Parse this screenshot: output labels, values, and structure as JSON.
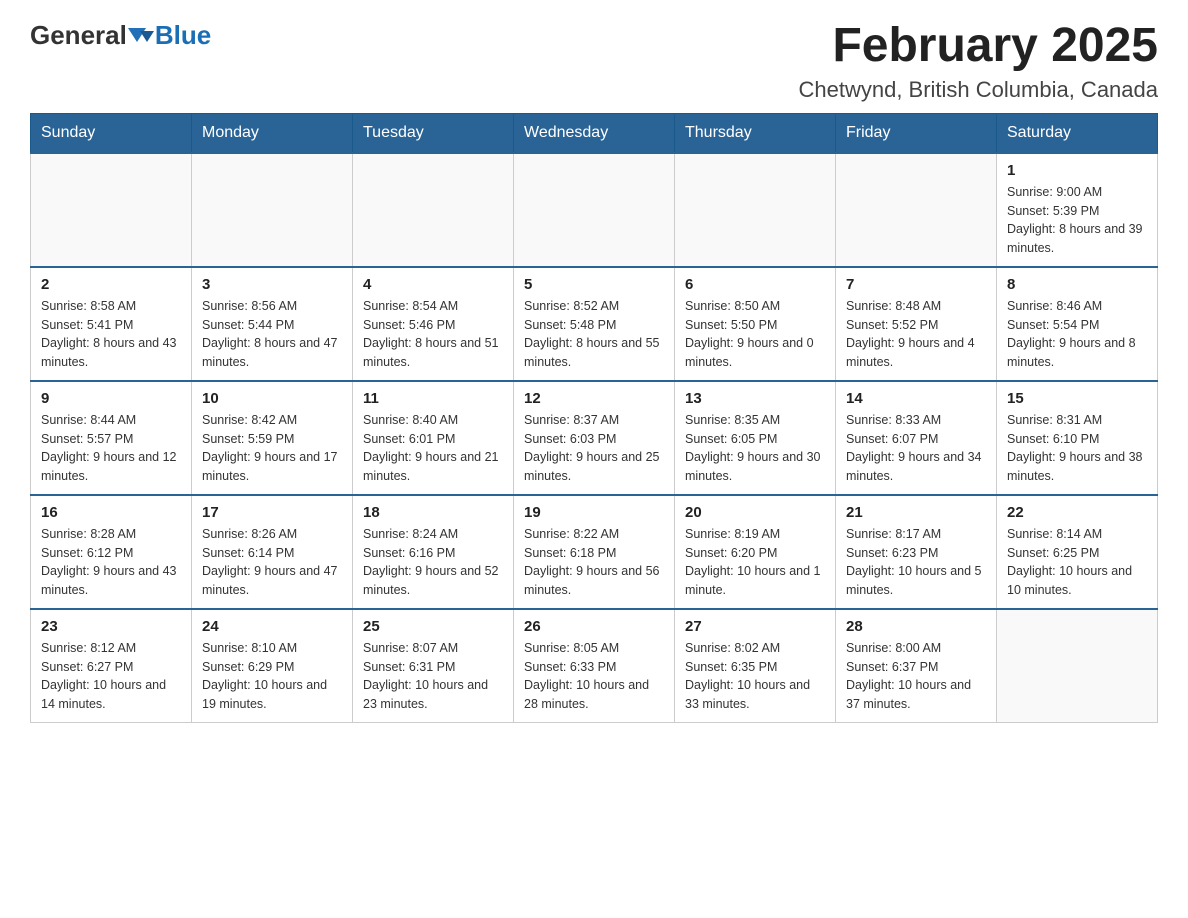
{
  "header": {
    "logo_general": "General",
    "logo_blue": "Blue",
    "title": "February 2025",
    "subtitle": "Chetwynd, British Columbia, Canada"
  },
  "days_of_week": [
    "Sunday",
    "Monday",
    "Tuesday",
    "Wednesday",
    "Thursday",
    "Friday",
    "Saturday"
  ],
  "weeks": [
    [
      {
        "day": "",
        "info": ""
      },
      {
        "day": "",
        "info": ""
      },
      {
        "day": "",
        "info": ""
      },
      {
        "day": "",
        "info": ""
      },
      {
        "day": "",
        "info": ""
      },
      {
        "day": "",
        "info": ""
      },
      {
        "day": "1",
        "info": "Sunrise: 9:00 AM\nSunset: 5:39 PM\nDaylight: 8 hours and 39 minutes."
      }
    ],
    [
      {
        "day": "2",
        "info": "Sunrise: 8:58 AM\nSunset: 5:41 PM\nDaylight: 8 hours and 43 minutes."
      },
      {
        "day": "3",
        "info": "Sunrise: 8:56 AM\nSunset: 5:44 PM\nDaylight: 8 hours and 47 minutes."
      },
      {
        "day": "4",
        "info": "Sunrise: 8:54 AM\nSunset: 5:46 PM\nDaylight: 8 hours and 51 minutes."
      },
      {
        "day": "5",
        "info": "Sunrise: 8:52 AM\nSunset: 5:48 PM\nDaylight: 8 hours and 55 minutes."
      },
      {
        "day": "6",
        "info": "Sunrise: 8:50 AM\nSunset: 5:50 PM\nDaylight: 9 hours and 0 minutes."
      },
      {
        "day": "7",
        "info": "Sunrise: 8:48 AM\nSunset: 5:52 PM\nDaylight: 9 hours and 4 minutes."
      },
      {
        "day": "8",
        "info": "Sunrise: 8:46 AM\nSunset: 5:54 PM\nDaylight: 9 hours and 8 minutes."
      }
    ],
    [
      {
        "day": "9",
        "info": "Sunrise: 8:44 AM\nSunset: 5:57 PM\nDaylight: 9 hours and 12 minutes."
      },
      {
        "day": "10",
        "info": "Sunrise: 8:42 AM\nSunset: 5:59 PM\nDaylight: 9 hours and 17 minutes."
      },
      {
        "day": "11",
        "info": "Sunrise: 8:40 AM\nSunset: 6:01 PM\nDaylight: 9 hours and 21 minutes."
      },
      {
        "day": "12",
        "info": "Sunrise: 8:37 AM\nSunset: 6:03 PM\nDaylight: 9 hours and 25 minutes."
      },
      {
        "day": "13",
        "info": "Sunrise: 8:35 AM\nSunset: 6:05 PM\nDaylight: 9 hours and 30 minutes."
      },
      {
        "day": "14",
        "info": "Sunrise: 8:33 AM\nSunset: 6:07 PM\nDaylight: 9 hours and 34 minutes."
      },
      {
        "day": "15",
        "info": "Sunrise: 8:31 AM\nSunset: 6:10 PM\nDaylight: 9 hours and 38 minutes."
      }
    ],
    [
      {
        "day": "16",
        "info": "Sunrise: 8:28 AM\nSunset: 6:12 PM\nDaylight: 9 hours and 43 minutes."
      },
      {
        "day": "17",
        "info": "Sunrise: 8:26 AM\nSunset: 6:14 PM\nDaylight: 9 hours and 47 minutes."
      },
      {
        "day": "18",
        "info": "Sunrise: 8:24 AM\nSunset: 6:16 PM\nDaylight: 9 hours and 52 minutes."
      },
      {
        "day": "19",
        "info": "Sunrise: 8:22 AM\nSunset: 6:18 PM\nDaylight: 9 hours and 56 minutes."
      },
      {
        "day": "20",
        "info": "Sunrise: 8:19 AM\nSunset: 6:20 PM\nDaylight: 10 hours and 1 minute."
      },
      {
        "day": "21",
        "info": "Sunrise: 8:17 AM\nSunset: 6:23 PM\nDaylight: 10 hours and 5 minutes."
      },
      {
        "day": "22",
        "info": "Sunrise: 8:14 AM\nSunset: 6:25 PM\nDaylight: 10 hours and 10 minutes."
      }
    ],
    [
      {
        "day": "23",
        "info": "Sunrise: 8:12 AM\nSunset: 6:27 PM\nDaylight: 10 hours and 14 minutes."
      },
      {
        "day": "24",
        "info": "Sunrise: 8:10 AM\nSunset: 6:29 PM\nDaylight: 10 hours and 19 minutes."
      },
      {
        "day": "25",
        "info": "Sunrise: 8:07 AM\nSunset: 6:31 PM\nDaylight: 10 hours and 23 minutes."
      },
      {
        "day": "26",
        "info": "Sunrise: 8:05 AM\nSunset: 6:33 PM\nDaylight: 10 hours and 28 minutes."
      },
      {
        "day": "27",
        "info": "Sunrise: 8:02 AM\nSunset: 6:35 PM\nDaylight: 10 hours and 33 minutes."
      },
      {
        "day": "28",
        "info": "Sunrise: 8:00 AM\nSunset: 6:37 PM\nDaylight: 10 hours and 37 minutes."
      },
      {
        "day": "",
        "info": ""
      }
    ]
  ]
}
